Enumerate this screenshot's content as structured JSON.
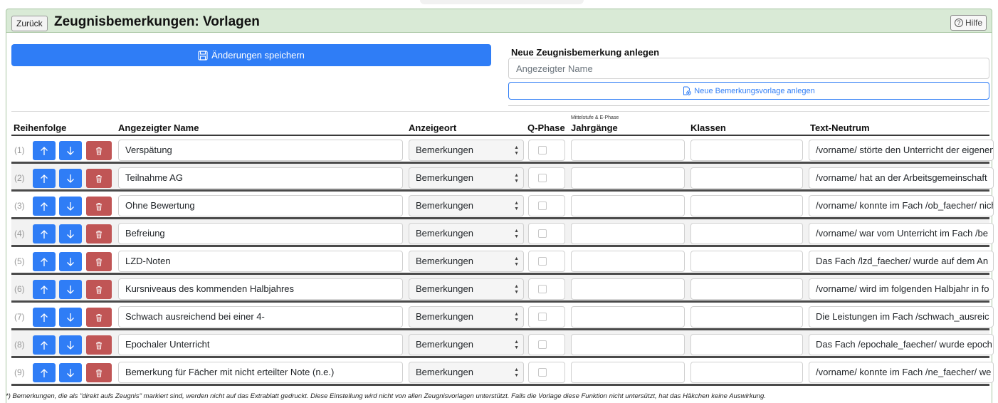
{
  "header": {
    "back_label": "Zurück",
    "title": "Zeugnisbemerkungen: Vorlagen",
    "help_label": "Hilfe"
  },
  "toolbar": {
    "save_label": "Änderungen speichern"
  },
  "new_entry": {
    "heading": "Neue Zeugnisbemerkung anlegen",
    "placeholder": "Angezeigter Name",
    "button_label": "Neue Bemerkungsvorlage anlegen"
  },
  "table": {
    "headers": {
      "order": "Reihenfolge",
      "name": "Angezeigter Name",
      "location": "Anzeigeort",
      "qphase": "Q-Phase",
      "years_small": "Mittelstufe & E-Phase",
      "years": "Jahrgänge",
      "classes": "Klassen",
      "text": "Text-Neutrum"
    },
    "rows": [
      {
        "num": "(1)",
        "name": "Verspätung",
        "location": "Bemerkungen",
        "text": "/vorname/ störte den Unterricht der eigenen"
      },
      {
        "num": "(2)",
        "name": "Teilnahme AG",
        "location": "Bemerkungen",
        "text": "/vorname/ hat an der Arbeitsgemeinschaft"
      },
      {
        "num": "(3)",
        "name": "Ohne Bewertung",
        "location": "Bemerkungen",
        "text": "/vorname/ konnte im Fach /ob_faecher/ nicht"
      },
      {
        "num": "(4)",
        "name": "Befreiung",
        "location": "Bemerkungen",
        "text": "/vorname/ war vom Unterricht im Fach /be"
      },
      {
        "num": "(5)",
        "name": "LZD-Noten",
        "location": "Bemerkungen",
        "text": "Das Fach /lzd_faecher/ wurde auf dem An"
      },
      {
        "num": "(6)",
        "name": "Kursniveaus des kommenden Halbjahres",
        "location": "Bemerkungen",
        "text": "/vorname/ wird im folgenden Halbjahr in fo"
      },
      {
        "num": "(7)",
        "name": "Schwach ausreichend bei einer 4-",
        "location": "Bemerkungen",
        "text": "Die Leistungen im Fach /schwach_ausreic"
      },
      {
        "num": "(8)",
        "name": "Epochaler Unterricht",
        "location": "Bemerkungen",
        "text": "Das Fach /epochale_faecher/ wurde epoch"
      },
      {
        "num": "(9)",
        "name": "Bemerkung für Fächer mit nicht erteilter Note (n.e.)",
        "location": "Bemerkungen",
        "text": "/vorname/ konnte im Fach /ne_faecher/ we"
      }
    ]
  },
  "footnote": "*) Bemerkungen, die als \"direkt aufs Zeugnis\" markiert sind, werden nicht auf das Extrablatt gedruckt. Diese Einstellung wird nicht von allen Zeugnisvorlagen unterstützt. Falls die Vorlage diese Funktion nicht untersützt, hat das Häkchen keine Auswirkung."
}
